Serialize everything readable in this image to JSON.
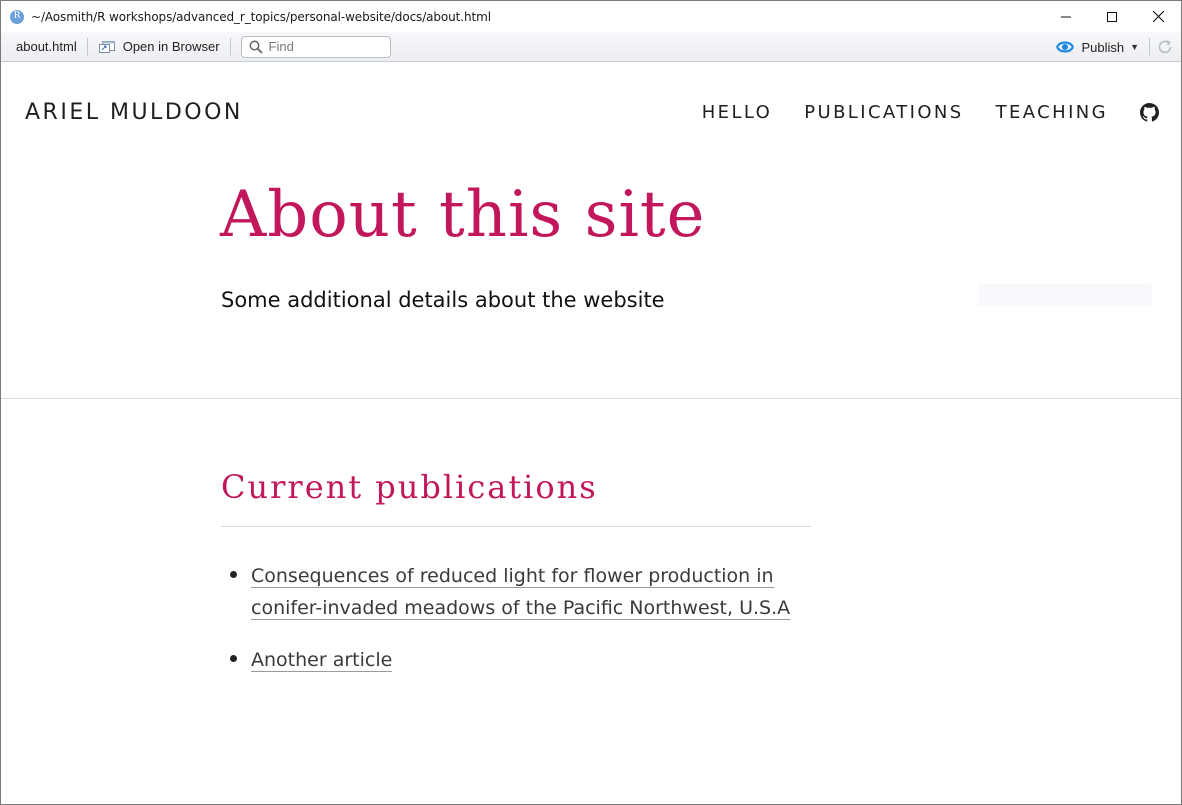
{
  "window": {
    "title": "~/Aosmith/R workshops/advanced_r_topics/personal-website/docs/about.html",
    "app_icon_letter": "R"
  },
  "toolbar": {
    "file_name": "about.html",
    "open_in_browser_label": "Open in Browser",
    "find_placeholder": "Find",
    "publish_label": "Publish"
  },
  "site": {
    "brand": "ARIEL MULDOON",
    "nav": [
      {
        "label": "HELLO"
      },
      {
        "label": "PUBLICATIONS"
      },
      {
        "label": "TEACHING"
      }
    ],
    "nav_icon": "github-icon"
  },
  "hero": {
    "title": "About this site",
    "subtitle": "Some additional details about the website"
  },
  "section": {
    "title": "Current publications",
    "items": [
      {
        "text": "Consequences of reduced light for flower production in conifer-invaded meadows of the Pacific Northwest, U.S.A"
      },
      {
        "text": "Another article"
      }
    ]
  },
  "colors": {
    "accent": "#c2185b",
    "publish_icon": "#1e88e5"
  }
}
